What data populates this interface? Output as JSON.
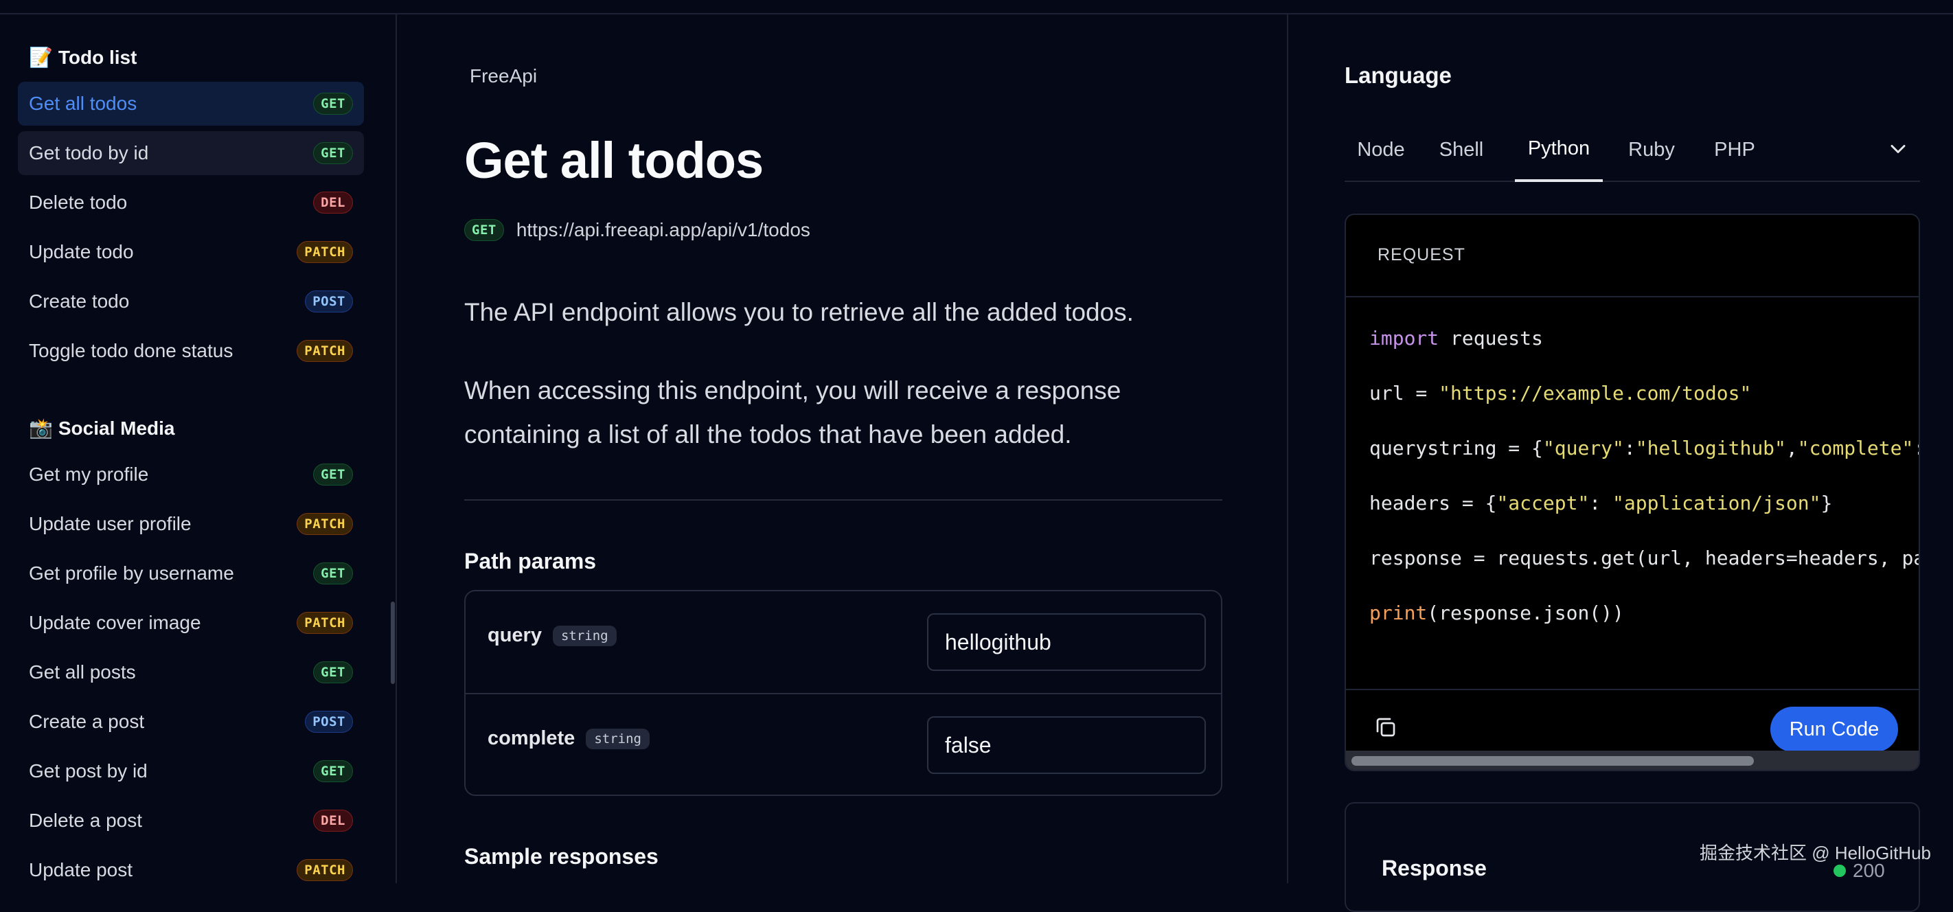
{
  "sidebar": {
    "groups": [
      {
        "title": "Todo list",
        "icon": "memo-icon",
        "items": [
          {
            "label": "Get all todos",
            "method": "GET"
          },
          {
            "label": "Get todo by id",
            "method": "GET"
          },
          {
            "label": "Delete todo",
            "method": "DEL"
          },
          {
            "label": "Update todo",
            "method": "PATCH"
          },
          {
            "label": "Create todo",
            "method": "POST"
          },
          {
            "label": "Toggle todo done status",
            "method": "PATCH"
          }
        ]
      },
      {
        "title": "Social Media",
        "icon": "camera-flash-icon",
        "items": [
          {
            "label": "Get my profile",
            "method": "GET"
          },
          {
            "label": "Update user profile",
            "method": "PATCH"
          },
          {
            "label": "Get profile by username",
            "method": "GET"
          },
          {
            "label": "Update cover image",
            "method": "PATCH"
          },
          {
            "label": "Get all posts",
            "method": "GET"
          },
          {
            "label": "Create a post",
            "method": "POST"
          },
          {
            "label": "Get post by id",
            "method": "GET"
          },
          {
            "label": "Delete a post",
            "method": "DEL"
          },
          {
            "label": "Update post",
            "method": "PATCH"
          }
        ]
      }
    ]
  },
  "main": {
    "breadcrumb": "FreeApi",
    "title": "Get all todos",
    "method": "GET",
    "url": "https://api.freeapi.app/api/v1/todos",
    "description_1": "The API endpoint allows you to retrieve all the added todos.",
    "description_2": "When accessing this endpoint, you will receive a response containing a list of all the todos that have been added.",
    "path_params_title": "Path params",
    "params": [
      {
        "name": "query",
        "type": "string",
        "value": "hellogithub"
      },
      {
        "name": "complete",
        "type": "string",
        "value": "false"
      }
    ],
    "sample_responses_title": "Sample responses"
  },
  "right": {
    "language_title": "Language",
    "tabs": [
      "Node",
      "Shell",
      "Python",
      "Ruby",
      "PHP"
    ],
    "active_tab": "Python",
    "request_label": "REQUEST",
    "run_button": "Run Code",
    "response_title": "Response",
    "status_code": "200"
  },
  "watermark": "掘金技术社区 @ HelloGitHub",
  "colors": {
    "background": "#050816",
    "accent": "#2563eb",
    "active_nav_text": "#4f8ef7",
    "get": "#86efac",
    "delete": "#fca5a5",
    "patch": "#fcd34d",
    "post": "#93c5fd"
  }
}
